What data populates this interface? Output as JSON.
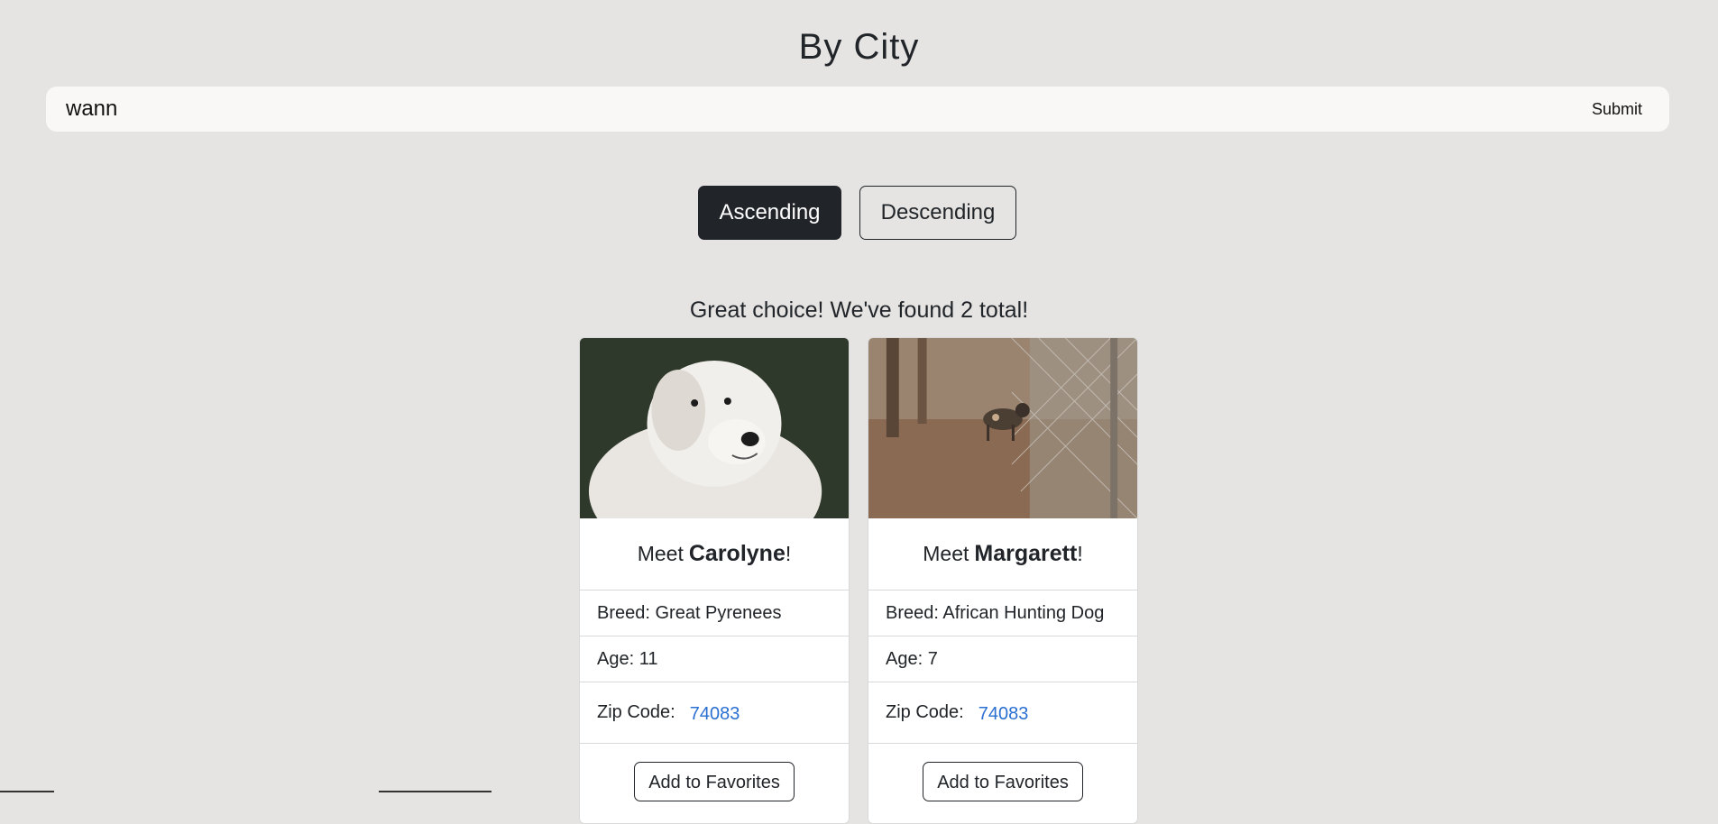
{
  "page": {
    "title": "By City"
  },
  "search": {
    "value": "wann",
    "submit_label": "Submit"
  },
  "sort": {
    "ascending_label": "Ascending",
    "descending_label": "Descending",
    "selected": "Ascending"
  },
  "results": {
    "summary": "Great choice! We've found 2 total!"
  },
  "cards": [
    {
      "meet_prefix": "Meet",
      "name": "Carolyne",
      "suffix": "!",
      "breed": "Breed: Great Pyrenees",
      "age": "Age: 11",
      "zip_label": "Zip Code:",
      "zip_value": "74083",
      "button_label": "Add to Favorites"
    },
    {
      "meet_prefix": "Meet",
      "name": "Margarett",
      "suffix": "!",
      "breed": "Breed: African Hunting Dog",
      "age": "Age: 7",
      "zip_label": "Zip Code:",
      "zip_value": "74083",
      "button_label": "Add to Favorites"
    }
  ],
  "colors": {
    "background": "#e5e4e2",
    "dark": "#212529",
    "link": "#2a6fd1"
  }
}
